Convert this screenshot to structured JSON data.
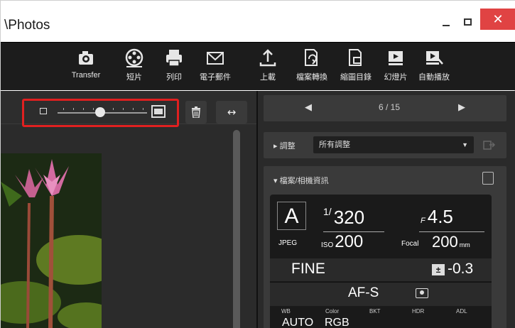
{
  "window": {
    "title": "\\Photos",
    "minimize_label": "",
    "maximize_label": "",
    "close_label": "✕"
  },
  "toolbar": {
    "items": [
      {
        "label": "Transfer",
        "icon": "camera-transfer-icon"
      },
      {
        "label": "短片",
        "icon": "film-reel-icon"
      },
      {
        "label": "列印",
        "icon": "printer-icon"
      },
      {
        "label": "電子郵件",
        "icon": "envelope-icon"
      },
      {
        "label": "上載",
        "icon": "upload-icon"
      },
      {
        "label": "檔案轉換",
        "icon": "file-convert-icon"
      },
      {
        "label": "縮圖目錄",
        "icon": "thumbnail-catalog-icon"
      },
      {
        "label": "幻燈片",
        "icon": "slideshow-icon"
      },
      {
        "label": "自動播放",
        "icon": "autoplay-icon"
      }
    ]
  },
  "left_panel": {
    "zoom_slider_value": 0.5,
    "arrow_button_label": "↔"
  },
  "right_panel": {
    "nav": {
      "prev": "◀",
      "count": "6 / 15",
      "next": "▶"
    },
    "adjust": {
      "label": "▸ 調整",
      "selected": "所有調整",
      "caret": "▼"
    },
    "file_info": {
      "label": "▾ 檔案/相機資訊"
    },
    "camera": {
      "mode": "A",
      "shutter_num": "1/",
      "shutter_den": "320",
      "aperture_prefix": "F",
      "aperture": "4.5",
      "format": "JPEG",
      "iso_label": "ISO",
      "iso": "200",
      "focal_label": "Focal",
      "focal": "200",
      "focal_unit": "mm",
      "quality": "FINE",
      "exposure_comp": "-0.3",
      "af_mode": "AF-S",
      "labels": [
        "WB",
        "Color",
        "BKT",
        "HDR",
        "ADL"
      ],
      "wb": "AUTO",
      "color": "RGB"
    }
  }
}
